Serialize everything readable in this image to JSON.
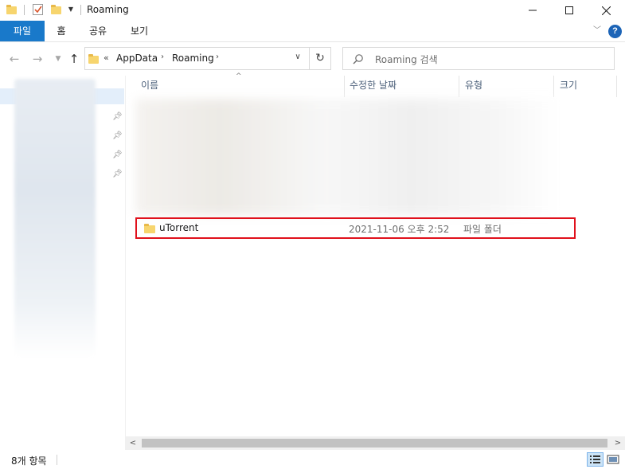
{
  "window": {
    "title": "Roaming",
    "controls": {
      "minimize": "minimize",
      "maximize": "maximize",
      "close": "close"
    }
  },
  "ribbon": {
    "tabs": [
      {
        "label": "파일",
        "active": true
      },
      {
        "label": "홈"
      },
      {
        "label": "공유"
      },
      {
        "label": "보기"
      }
    ],
    "help": "?"
  },
  "nav": {
    "breadcrumb_prefix": "«",
    "breadcrumb": [
      "AppData",
      "Roaming"
    ],
    "search_placeholder": "Roaming 검색"
  },
  "columns": {
    "name": "이름",
    "date": "수정한 날짜",
    "type": "유형",
    "size": "크기"
  },
  "files": [
    {
      "name": "uTorrent",
      "date": "2021-11-06 오후 2:52",
      "type": "파일 폴더",
      "size": "",
      "highlighted": true
    }
  ],
  "status": {
    "item_count": "8개 항목"
  },
  "colors": {
    "accent": "#1979ca",
    "highlight_border": "#e0111c",
    "folder": "#f7d56e"
  }
}
